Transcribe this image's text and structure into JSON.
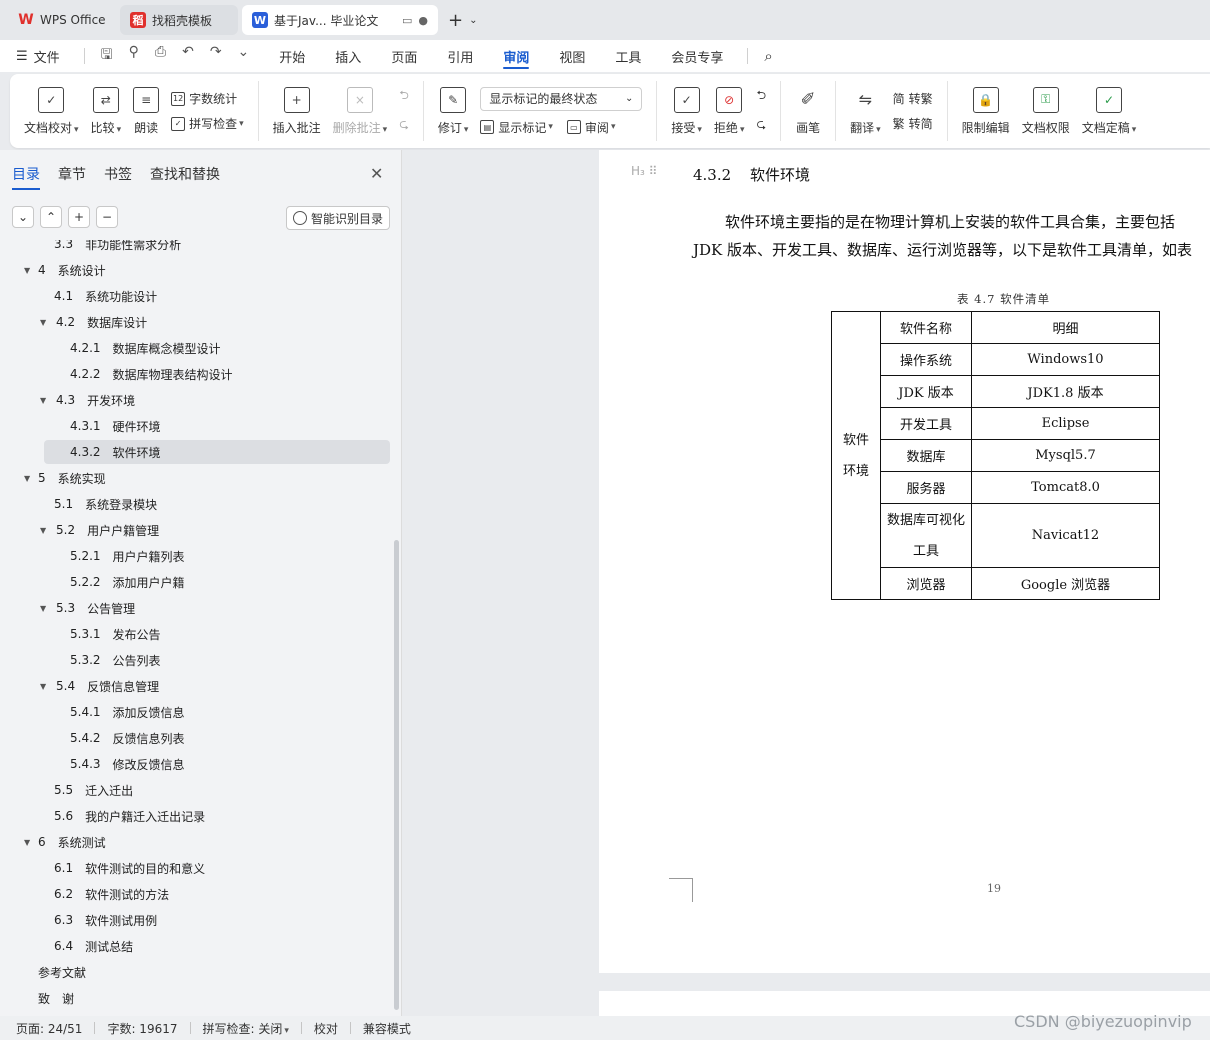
{
  "tabs": [
    {
      "label": "WPS Office",
      "icon": "wps-logo-icon"
    },
    {
      "label": "找稻壳模板",
      "icon": "daoke-logo-icon"
    },
    {
      "label": "基于Jav... 毕业论文",
      "icon": "word-doc-icon",
      "active": true
    }
  ],
  "menu": {
    "file_label": "文件",
    "items": [
      "开始",
      "插入",
      "页面",
      "引用",
      "审阅",
      "视图",
      "工具",
      "会员专享"
    ],
    "active": "审阅"
  },
  "ribbon": {
    "doc_check": "文档校对",
    "compare": "比较",
    "read_aloud": "朗读",
    "word_count": "字数统计",
    "spell_check": "拼写检查",
    "insert_comment": "插入批注",
    "delete_comment": "删除批注",
    "revise": "修订",
    "display_state": "显示标记的最终状态",
    "show_markup": "显示标记",
    "review_pane": "审阅",
    "accept": "接受",
    "reject": "拒绝",
    "pen": "画笔",
    "translate": "翻译",
    "to_traditional": "转繁",
    "to_simplified": "转简",
    "restrict_edit": "限制编辑",
    "doc_permission": "文档权限",
    "doc_finalize": "文档定稿"
  },
  "nav": {
    "tabs": [
      "目录",
      "章节",
      "书签",
      "查找和替换"
    ],
    "active_tab": "目录",
    "smart_toc": "智能识别目录",
    "toc": [
      {
        "num": "3.3",
        "title": "非功能性需求分析",
        "level": 2
      },
      {
        "num": "4",
        "title": "系统设计",
        "level": 1,
        "expand": true
      },
      {
        "num": "4.1",
        "title": "系统功能设计",
        "level": 2
      },
      {
        "num": "4.2",
        "title": "数据库设计",
        "level": 2,
        "expand": true
      },
      {
        "num": "4.2.1",
        "title": "数据库概念模型设计",
        "level": 3
      },
      {
        "num": "4.2.2",
        "title": "数据库物理表结构设计",
        "level": 3
      },
      {
        "num": "4.3",
        "title": "开发环境",
        "level": 2,
        "expand": true
      },
      {
        "num": "4.3.1",
        "title": "硬件环境",
        "level": 3
      },
      {
        "num": "4.3.2",
        "title": "软件环境",
        "level": 3,
        "selected": true
      },
      {
        "num": "5",
        "title": "系统实现",
        "level": 1,
        "expand": true
      },
      {
        "num": "5.1",
        "title": "系统登录模块",
        "level": 2
      },
      {
        "num": "5.2",
        "title": "用户户籍管理",
        "level": 2,
        "expand": true
      },
      {
        "num": "5.2.1",
        "title": "用户户籍列表",
        "level": 3
      },
      {
        "num": "5.2.2",
        "title": "添加用户户籍",
        "level": 3
      },
      {
        "num": "5.3",
        "title": "公告管理",
        "level": 2,
        "expand": true
      },
      {
        "num": "5.3.1",
        "title": "发布公告",
        "level": 3
      },
      {
        "num": "5.3.2",
        "title": "公告列表",
        "level": 3
      },
      {
        "num": "5.4",
        "title": "反馈信息管理",
        "level": 2,
        "expand": true
      },
      {
        "num": "5.4.1",
        "title": "添加反馈信息",
        "level": 3
      },
      {
        "num": "5.4.2",
        "title": "反馈信息列表",
        "level": 3
      },
      {
        "num": "5.4.3",
        "title": "修改反馈信息",
        "level": 3
      },
      {
        "num": "5.5",
        "title": "迁入迁出",
        "level": 2
      },
      {
        "num": "5.6",
        "title": "我的户籍迁入迁出记录",
        "level": 2
      },
      {
        "num": "6",
        "title": "系统测试",
        "level": 1,
        "expand": true
      },
      {
        "num": "6.1",
        "title": "软件测试的目的和意义",
        "level": 2
      },
      {
        "num": "6.2",
        "title": "软件测试的方法",
        "level": 2
      },
      {
        "num": "6.3",
        "title": "软件测试用例",
        "level": 2
      },
      {
        "num": "6.4",
        "title": "测试总结",
        "level": 2
      },
      {
        "num": "",
        "title": "参考文献",
        "level": 0
      },
      {
        "num": "",
        "title": "致　谢",
        "level": 0
      }
    ]
  },
  "document": {
    "heading_marker": "H",
    "heading_number": "4.3.2",
    "heading_title": "软件环境",
    "paragraph_line1": "软件环境主要指的是在物理计算机上安装的软件工具合集，主要包括",
    "paragraph_line2": "JDK 版本、开发工具、数据库、运行浏览器等，以下是软件工具清单，如表",
    "table_caption": "表 4.7  软件清单",
    "table_group_label_1": "软件",
    "table_group_label_2": "环境",
    "table_rows": [
      {
        "k": "软件名称",
        "v": "明细"
      },
      {
        "k": "操作系统",
        "v": "Windows10"
      },
      {
        "k": "JDK 版本",
        "v": "JDK1.8 版本"
      },
      {
        "k": "开发工具",
        "v": "Eclipse"
      },
      {
        "k": "数据库",
        "v": "Mysql5.7"
      },
      {
        "k": "服务器",
        "v": "Tomcat8.0"
      },
      {
        "k": "数据库可视化工具",
        "v": "Navicat12"
      },
      {
        "k": "浏览器",
        "v": "Google 浏览器"
      }
    ],
    "page_number": "19"
  },
  "status": {
    "page": "页面: 24/51",
    "words": "字数: 19617",
    "spell": "拼写检查: 关闭",
    "proof": "校对",
    "compat": "兼容模式"
  },
  "watermark": "CSDN @biyezuopinvip"
}
